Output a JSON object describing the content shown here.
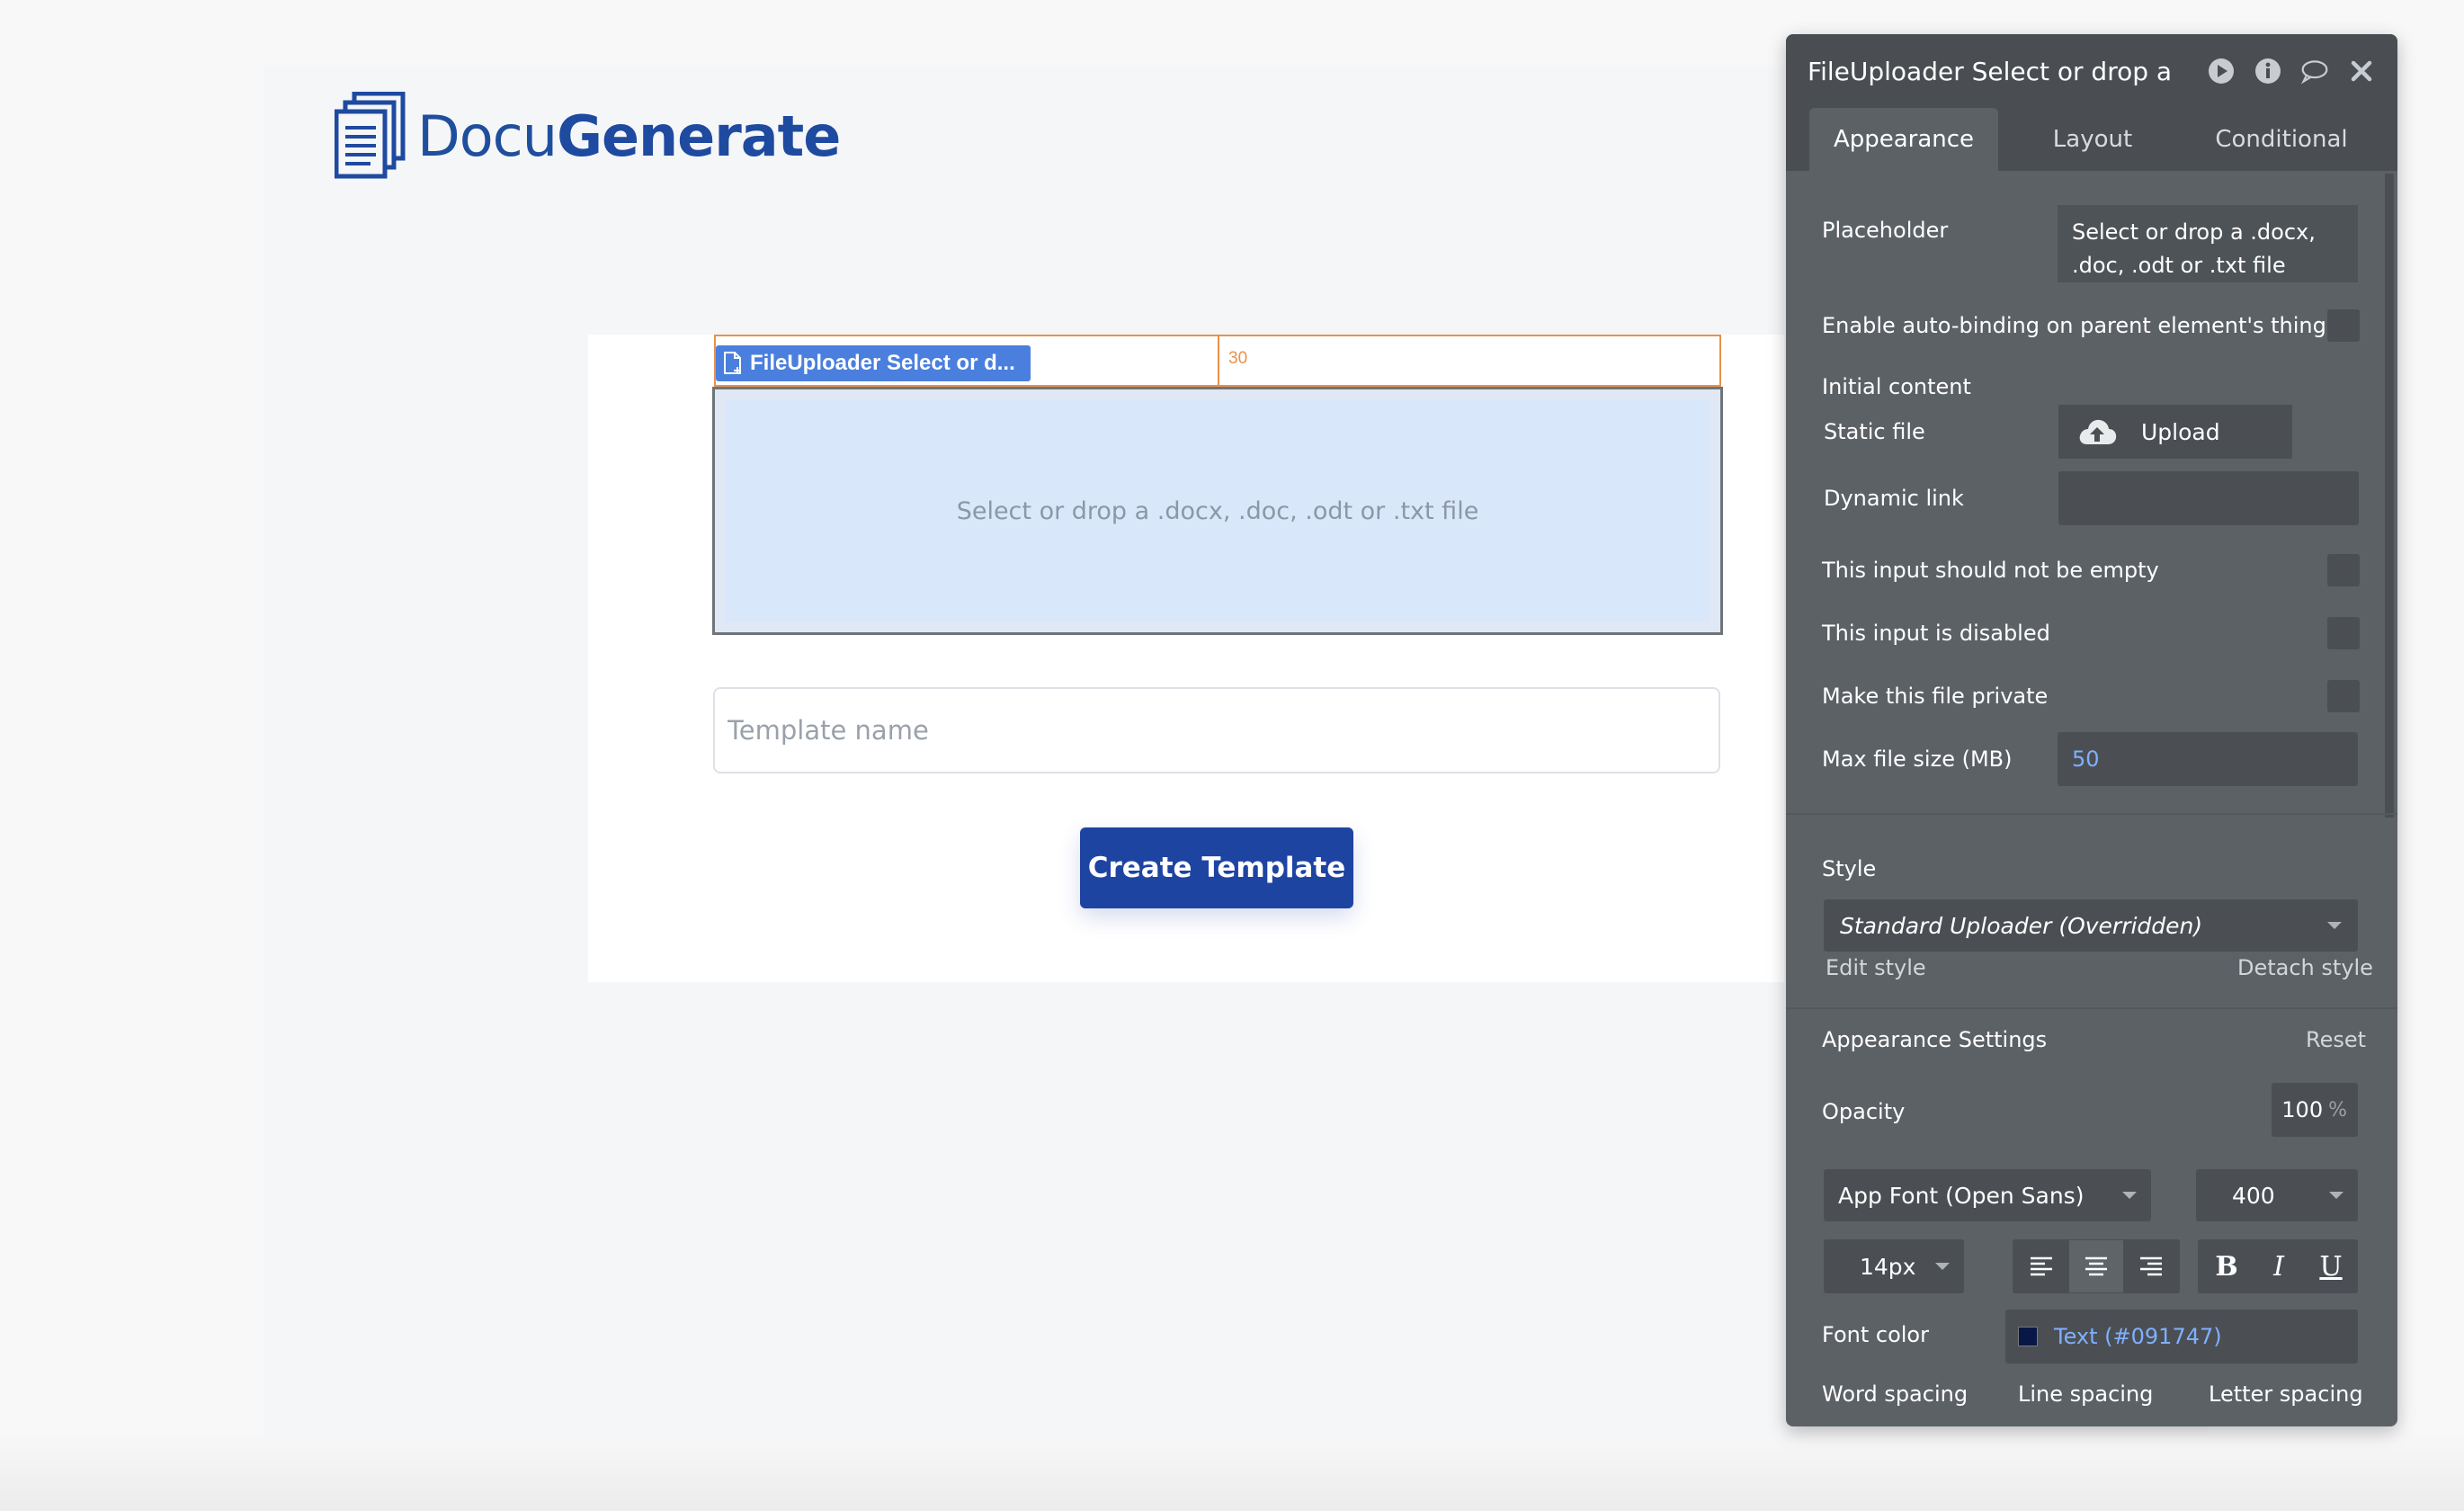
{
  "logo": {
    "prefix": "Docu",
    "bold": "Generate"
  },
  "canvas": {
    "element_tag": "FileUploader Select or d...",
    "dimension_label": "30",
    "uploader_placeholder": "Select or drop a .docx, .doc, .odt or .txt file",
    "template_name_placeholder": "Template name",
    "create_button": "Create Template"
  },
  "panel": {
    "title": "FileUploader Select or drop a .dc",
    "header_icons": [
      "play-icon",
      "info-icon",
      "comment-icon",
      "close-icon"
    ],
    "tabs": [
      "Appearance",
      "Layout",
      "Conditional"
    ],
    "active_tab": "Appearance",
    "placeholder_label": "Placeholder",
    "placeholder_value": "Select or drop a .docx, .doc, .odt or .txt file",
    "autobinding_label": "Enable auto-binding on parent element's thing",
    "initial_content_label": "Initial content",
    "static_file_label": "Static file",
    "upload_label": "Upload",
    "dynamic_link_label": "Dynamic link",
    "not_empty_label": "This input should not be empty",
    "disabled_label": "This input is disabled",
    "private_label": "Make this file private",
    "max_size_label": "Max file size (MB)",
    "max_size_value": "50",
    "style_label": "Style",
    "style_value": "Standard Uploader (Overridden)",
    "edit_style": "Edit style",
    "detach_style": "Detach style",
    "appearance_settings": "Appearance Settings",
    "reset": "Reset",
    "opacity_label": "Opacity",
    "opacity_value": "100",
    "opacity_unit": "%",
    "font_family": "App Font (Open Sans)",
    "font_weight": "400",
    "font_size": "14px",
    "bold_glyph": "B",
    "italic_glyph": "I",
    "underline_glyph": "U",
    "font_color_label": "Font color",
    "font_color_value": "Text (#091747)",
    "font_color_swatch": "#091747",
    "word_spacing": "Word spacing",
    "line_spacing": "Line spacing",
    "letter_spacing": "Letter spacing"
  },
  "colors": {
    "brand": "#1e44a2",
    "outline": "#e8924a",
    "tag": "#4a7fde",
    "panel": "#5c6166",
    "link": "#7fb0ff"
  }
}
